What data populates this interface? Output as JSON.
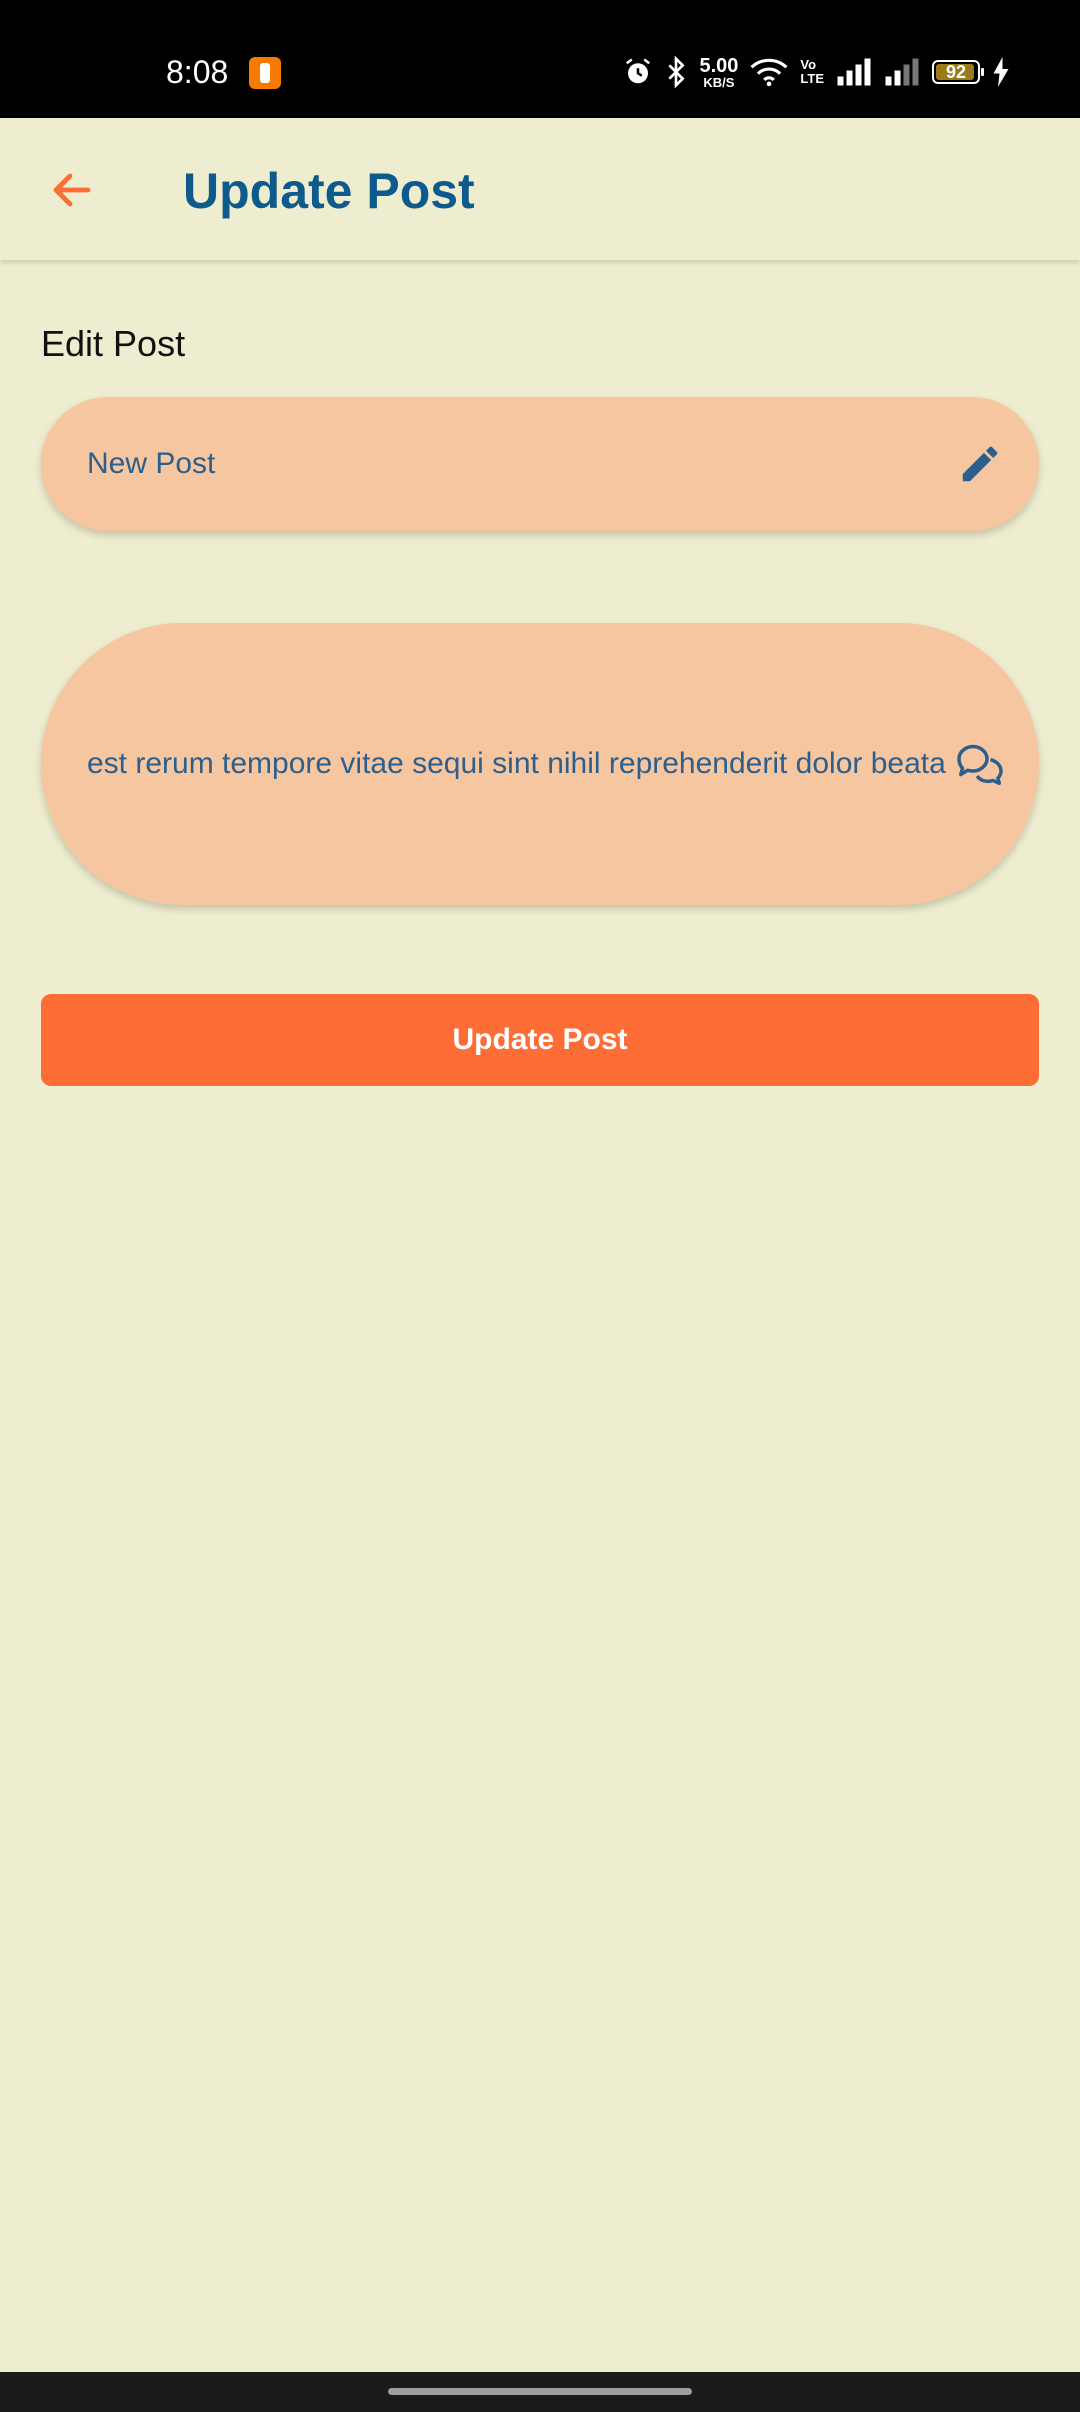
{
  "status_bar": {
    "time": "8:08",
    "net_speed_value": "5.00",
    "net_speed_unit": "KB/S",
    "volte_top": "Vo",
    "volte_bottom": "LTE",
    "battery_level": "92",
    "icons": [
      "app-notification-icon",
      "alarm-icon",
      "bluetooth-icon",
      "wifi-icon",
      "signal-icon",
      "signal-icon",
      "battery-icon",
      "charging-icon"
    ]
  },
  "app_bar": {
    "title": "Update Post",
    "back_icon": "arrow-back-icon"
  },
  "form": {
    "section_label": "Edit Post",
    "title_value": "New Post",
    "title_icon": "edit-pencil-icon",
    "body_value": "est rerum tempore vitae sequi sint nihil reprehenderit dolor beatae",
    "body_icon": "chat-bubbles-icon",
    "submit_label": "Update Post"
  },
  "colors": {
    "background": "#EEEDCF",
    "title": "#0D5A8C",
    "accent": "#FF6D36",
    "field_fill": "#F6C6A0",
    "field_text": "#2C5F8E"
  }
}
